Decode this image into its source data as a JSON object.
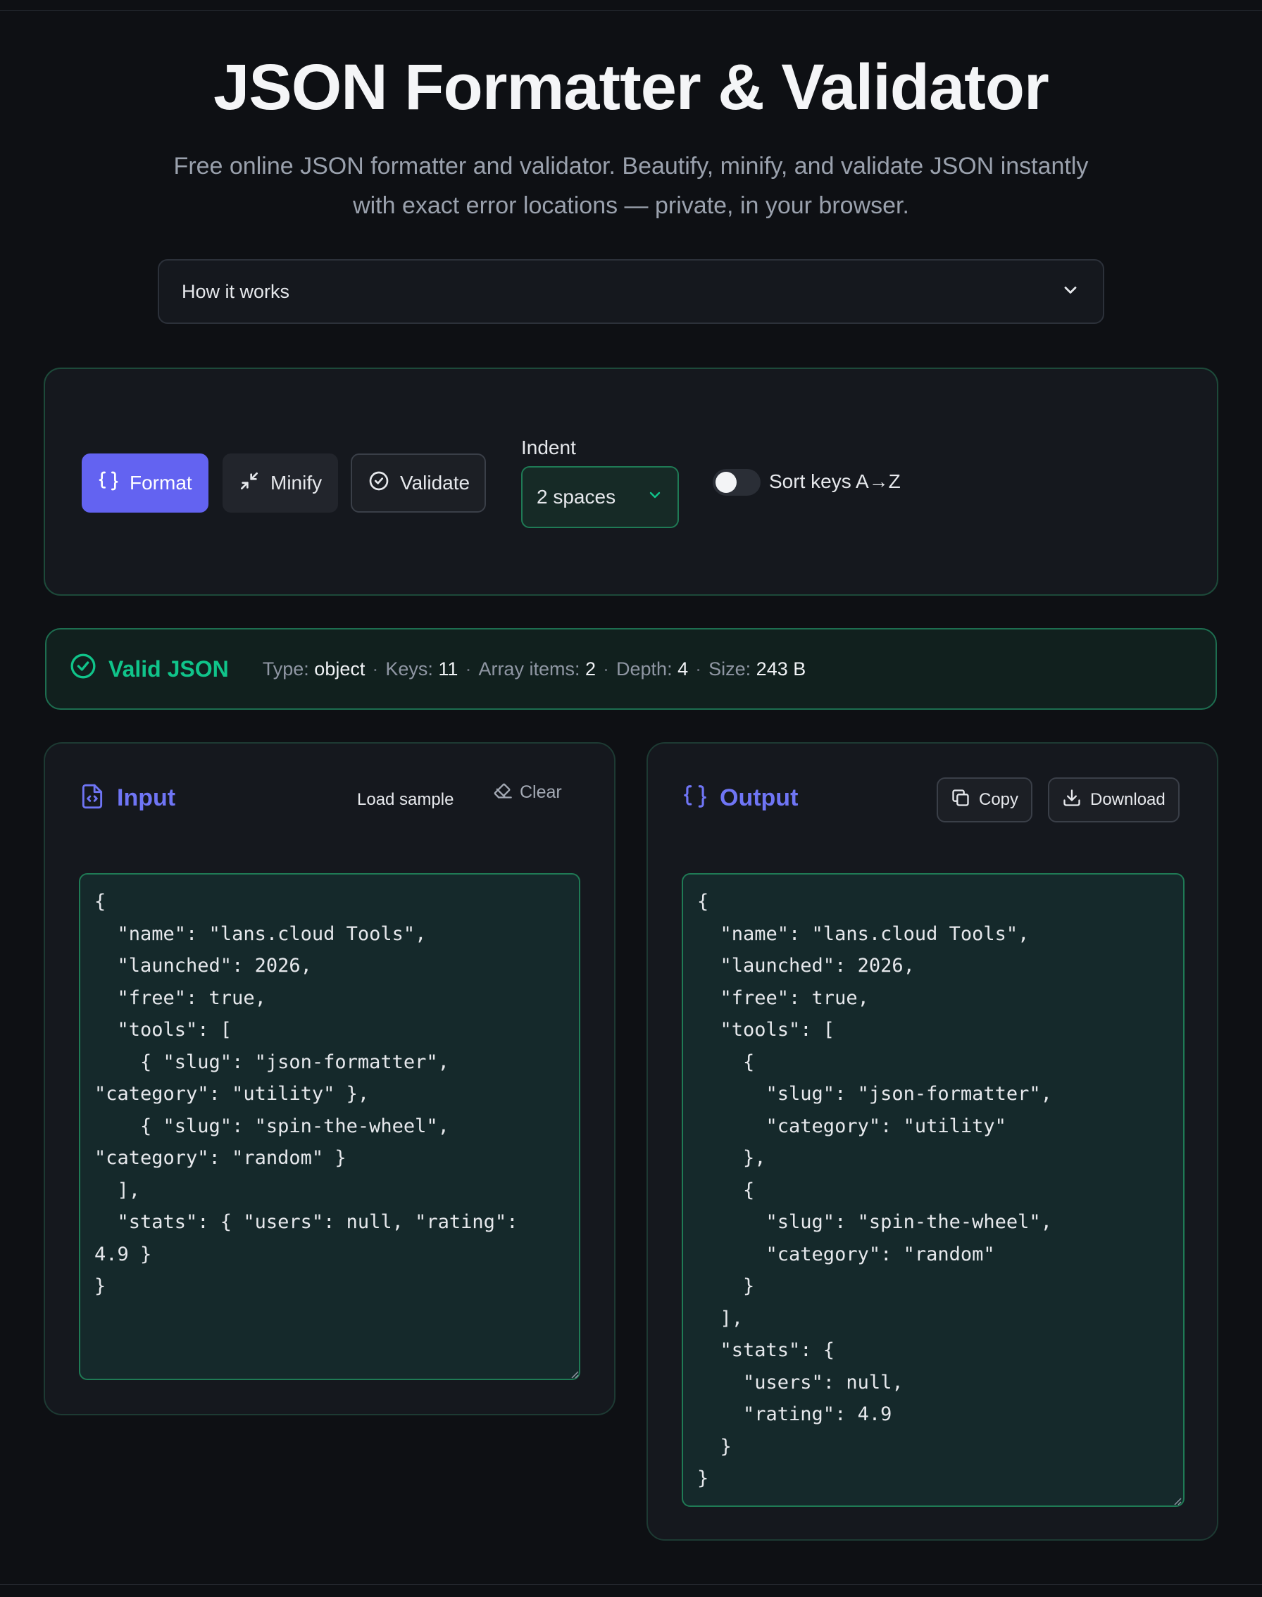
{
  "page": {
    "title": "JSON Formatter & Validator",
    "subtitle": "Free online JSON formatter and validator. Beautify, minify, and validate JSON instantly with exact error locations — private, in your browser."
  },
  "how_it_works": {
    "label": "How it works",
    "icon": "chevron-down-icon"
  },
  "toolbar": {
    "format_label": "Format",
    "minify_label": "Minify",
    "validate_label": "Validate",
    "indent_label": "Indent",
    "indent_value": "2 spaces",
    "sort_keys_label": "Sort keys A→Z",
    "sort_keys_enabled": false
  },
  "status": {
    "valid_label": "Valid JSON",
    "type_label": "Type:",
    "type_value": "object",
    "keys_label": "Keys:",
    "keys_value": "11",
    "array_items_label": "Array items:",
    "array_items_value": "2",
    "depth_label": "Depth:",
    "depth_value": "4",
    "size_label": "Size:",
    "size_value": "243 B"
  },
  "input": {
    "title": "Input",
    "load_sample_label": "Load sample",
    "clear_label": "Clear",
    "text": "{\n  \"name\": \"lans.cloud Tools\",\n  \"launched\": 2026,\n  \"free\": true,\n  \"tools\": [\n    { \"slug\": \"json-formatter\",\n\"category\": \"utility\" },\n    { \"slug\": \"spin-the-wheel\",\n\"category\": \"random\" }\n  ],\n  \"stats\": { \"users\": null, \"rating\":\n4.9 }\n}"
  },
  "output": {
    "title": "Output",
    "copy_label": "Copy",
    "download_label": "Download",
    "text": "{\n  \"name\": \"lans.cloud Tools\",\n  \"launched\": 2026,\n  \"free\": true,\n  \"tools\": [\n    {\n      \"slug\": \"json-formatter\",\n      \"category\": \"utility\"\n    },\n    {\n      \"slug\": \"spin-the-wheel\",\n      \"category\": \"random\"\n    }\n  ],\n  \"stats\": {\n    \"users\": null,\n    \"rating\": 4.9\n  }\n}"
  },
  "colors": {
    "accent": "#6363f1",
    "success": "#10c48a",
    "background": "#0e1014",
    "panel": "#15181e",
    "editor": "#15292b"
  }
}
